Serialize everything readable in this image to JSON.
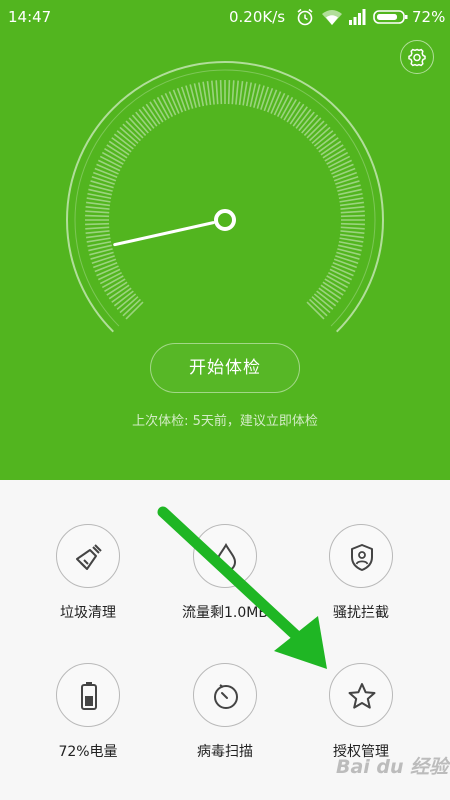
{
  "status_bar": {
    "time": "14:47",
    "net_speed": "0.20K/s",
    "battery_text": "72%",
    "icons": [
      "alarm-icon",
      "wifi-icon",
      "signal-icon",
      "battery-icon"
    ]
  },
  "header": {
    "settings_icon": "gear-icon"
  },
  "gauge": {
    "needle_level": 0.12
  },
  "start_button": {
    "label": "开始体检"
  },
  "last_check": {
    "text": "上次体检: 5天前，建议立即体检"
  },
  "tools": [
    {
      "label": "垃圾清理",
      "icon": "broom-icon"
    },
    {
      "label": "流量剩1.0MB",
      "icon": "water-drop-icon"
    },
    {
      "label": "骚扰拦截",
      "icon": "shield-user-icon"
    },
    {
      "label": "72%电量",
      "icon": "battery-icon"
    },
    {
      "label": "病毒扫描",
      "icon": "scan-dial-icon"
    },
    {
      "label": "授权管理",
      "icon": "star-icon"
    }
  ],
  "overlay": {
    "arrow": "green-arrow",
    "watermark": "Bai du 经验"
  },
  "colors": {
    "header_bg": "#52b51f",
    "body_bg": "#f7f7f7",
    "arrow": "#1fb624"
  }
}
